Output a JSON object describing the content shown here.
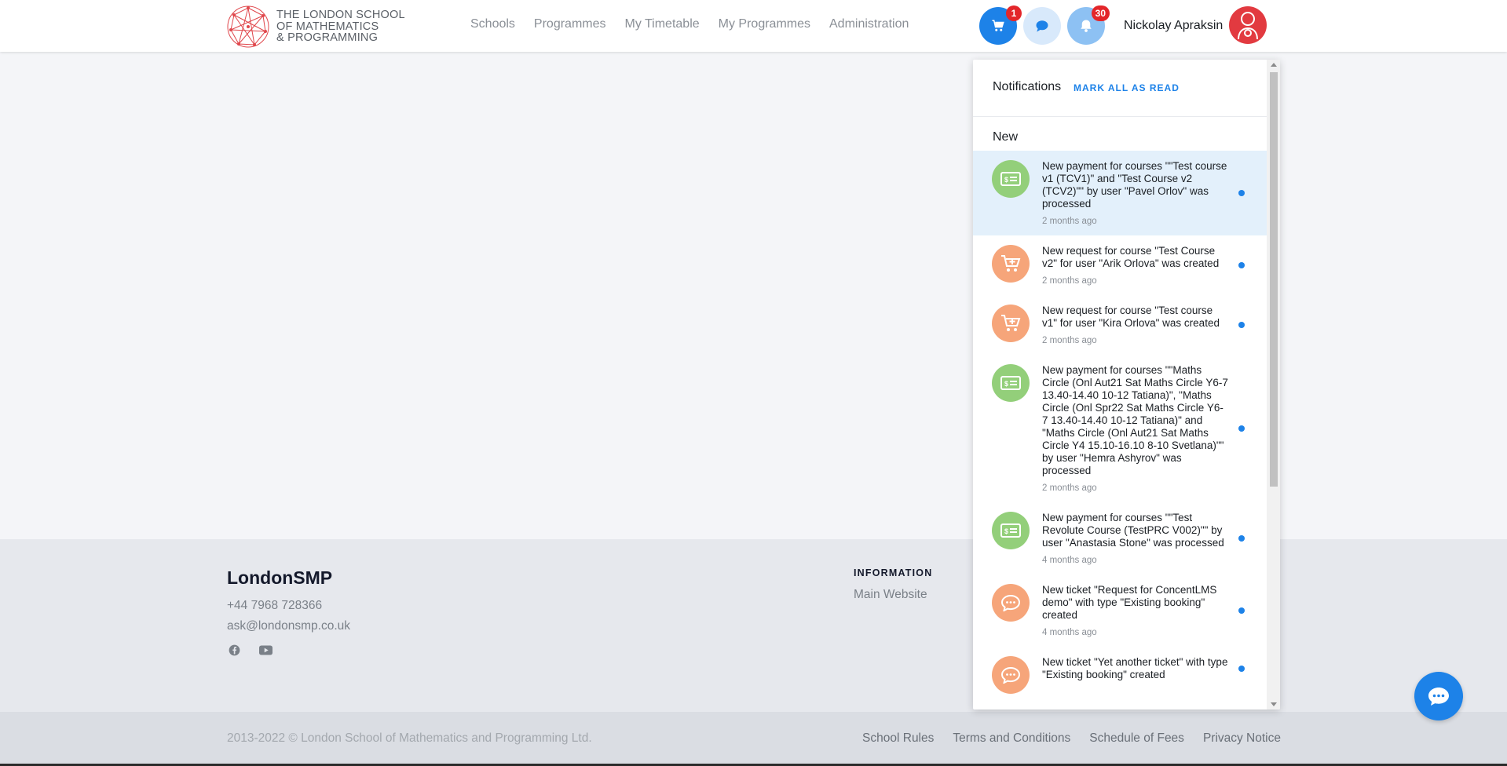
{
  "header": {
    "logo_lines": [
      "THE LONDON SCHOOL",
      "OF MATHEMATICS",
      "& PROGRAMMING"
    ],
    "nav": [
      "Schools",
      "Programmes",
      "My Timetable",
      "My Programmes",
      "Administration"
    ],
    "cart_badge": "1",
    "bell_badge": "30",
    "user_name": "Nickolay Apraksin"
  },
  "notifications": {
    "title": "Notifications",
    "mark_all": "MARK ALL AS READ",
    "section": "New",
    "items": [
      {
        "icon": "payment-icon",
        "color": "green",
        "active": true,
        "text": "New payment for courses \"\"Test course v1 (TCV1)\" and \"Test Course v2 (TCV2)\"\" by user \"Pavel Orlov\" was processed",
        "time": "2 months ago"
      },
      {
        "icon": "cart-add-icon",
        "color": "orange",
        "active": false,
        "text": "New request for course \"Test Course v2\" for user \"Arik Orlova\" was created",
        "time": "2 months ago"
      },
      {
        "icon": "cart-add-icon",
        "color": "orange",
        "active": false,
        "text": "New request for course \"Test course v1\" for user \"Kira Orlova\" was created",
        "time": "2 months ago"
      },
      {
        "icon": "payment-icon",
        "color": "green",
        "active": false,
        "text": "New payment for courses \"\"Maths Circle (Onl Aut21 Sat Maths Circle Y6-7 13.40-14.40 10-12 Tatiana)\", \"Maths Circle (Onl Spr22 Sat Maths Circle Y6-7 13.40-14.40 10-12 Tatiana)\" and \"Maths Circle (Onl Aut21 Sat Maths Circle Y4 15.10-16.10 8-10 Svetlana)\"\" by user \"Hemra Ashyrov\" was processed",
        "time": "2 months ago"
      },
      {
        "icon": "payment-icon",
        "color": "green",
        "active": false,
        "text": "New payment for courses \"\"Test Revolute Course (TestPRC V002)\"\" by user \"Anastasia Stone\" was processed",
        "time": "4 months ago"
      },
      {
        "icon": "ticket-icon",
        "color": "orange",
        "active": false,
        "text": "New ticket \"Request for ConcentLMS demo\" with type \"Existing booking\" created",
        "time": "4 months ago"
      },
      {
        "icon": "ticket-icon",
        "color": "orange",
        "active": false,
        "text": "New ticket \"Yet another ticket\" with type \"Existing booking\" created",
        "time": ""
      }
    ]
  },
  "footer": {
    "brand": "LondonSMP",
    "phone": "+44 7968 728366",
    "email": "ask@londonsmp.co.uk",
    "info_heading": "INFORMATION",
    "info_link": "Main Website",
    "copyright": "2013-2022 © London School of Mathematics and Programming Ltd.",
    "links": [
      "School Rules",
      "Terms and Conditions",
      "Schedule of Fees",
      "Privacy Notice"
    ]
  },
  "colors": {
    "accent": "#1d82e8",
    "badge": "#e3262a",
    "green_icon": "#93cf7a",
    "orange_icon": "#f6a57a"
  }
}
